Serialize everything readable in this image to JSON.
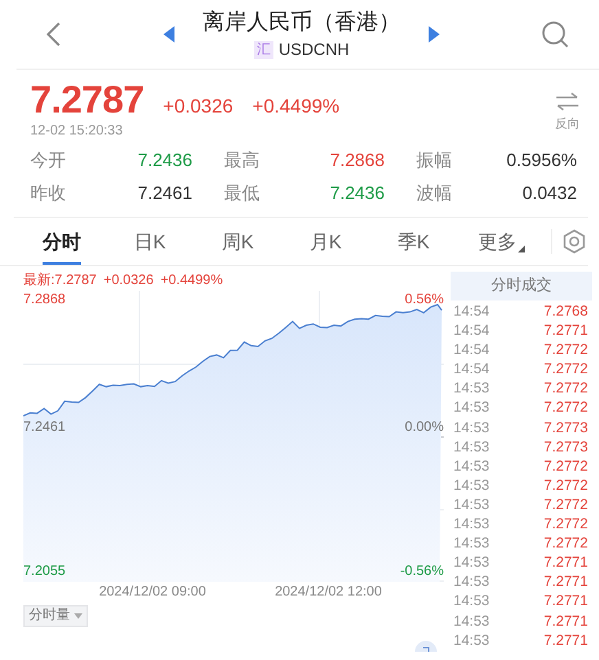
{
  "header": {
    "title": "离岸人民币（香港）",
    "badge": "汇",
    "symbol": "USDCNH"
  },
  "quote": {
    "price": "7.2787",
    "change": "+0.0326",
    "change_pct": "+0.4499%",
    "time": "12-02 15:20:33",
    "invert_label": "反向"
  },
  "stats": [
    {
      "label": "今开",
      "value": "7.2436",
      "color": "#1e9b47"
    },
    {
      "label": "最高",
      "value": "7.2868",
      "color": "#e4433b"
    },
    {
      "label": "振幅",
      "value": "0.5956%",
      "color": "#333333"
    },
    {
      "label": "昨收",
      "value": "7.2461",
      "color": "#333333"
    },
    {
      "label": "最低",
      "value": "7.2436",
      "color": "#1e9b47"
    },
    {
      "label": "波幅",
      "value": "0.0432",
      "color": "#333333"
    }
  ],
  "tabs": [
    {
      "label": "分时",
      "selected": true,
      "kind": "tab"
    },
    {
      "label": "日K",
      "selected": false,
      "kind": "tab"
    },
    {
      "label": "周K",
      "selected": false,
      "kind": "tab"
    },
    {
      "label": "月K",
      "selected": false,
      "kind": "tab"
    },
    {
      "label": "季K",
      "selected": false,
      "kind": "tab"
    },
    {
      "label": "更多",
      "selected": false,
      "kind": "menu"
    }
  ],
  "chart": {
    "legend": {
      "latest": "最新:7.2787",
      "change": "+0.0326",
      "change_pct": "+0.4499%"
    },
    "axis_labels": {
      "high": "7.2868",
      "high_pct": "0.56%",
      "base": "7.2461",
      "base_pct": "0.00%",
      "low": "7.2055",
      "low_pct": "-0.56%"
    },
    "x_labels": [
      "2024/12/02 09:00",
      "2024/12/02 12:00"
    ],
    "indicator": "分时量"
  },
  "trades": {
    "title": "分时成交",
    "rows": [
      {
        "time": "14:54",
        "price": "7.2768",
        "color": "#e4433b"
      },
      {
        "time": "14:54",
        "price": "7.2771",
        "color": "#e4433b"
      },
      {
        "time": "14:54",
        "price": "7.2772",
        "color": "#e4433b"
      },
      {
        "time": "14:54",
        "price": "7.2772",
        "color": "#e4433b"
      },
      {
        "time": "14:53",
        "price": "7.2772",
        "color": "#e4433b"
      },
      {
        "time": "14:53",
        "price": "7.2772",
        "color": "#e4433b"
      },
      {
        "time": "14:53",
        "price": "7.2773",
        "color": "#e4433b"
      },
      {
        "time": "14:53",
        "price": "7.2773",
        "color": "#e4433b"
      },
      {
        "time": "14:53",
        "price": "7.2772",
        "color": "#e4433b"
      },
      {
        "time": "14:53",
        "price": "7.2772",
        "color": "#e4433b"
      },
      {
        "time": "14:53",
        "price": "7.2772",
        "color": "#e4433b"
      },
      {
        "time": "14:53",
        "price": "7.2772",
        "color": "#e4433b"
      },
      {
        "time": "14:53",
        "price": "7.2772",
        "color": "#e4433b"
      },
      {
        "time": "14:53",
        "price": "7.2771",
        "color": "#e4433b"
      },
      {
        "time": "14:53",
        "price": "7.2771",
        "color": "#e4433b"
      },
      {
        "time": "14:53",
        "price": "7.2771",
        "color": "#e4433b"
      },
      {
        "time": "14:53",
        "price": "7.2771",
        "color": "#e4433b"
      },
      {
        "time": "14:53",
        "price": "7.2771",
        "color": "#e4433b"
      }
    ]
  }
}
